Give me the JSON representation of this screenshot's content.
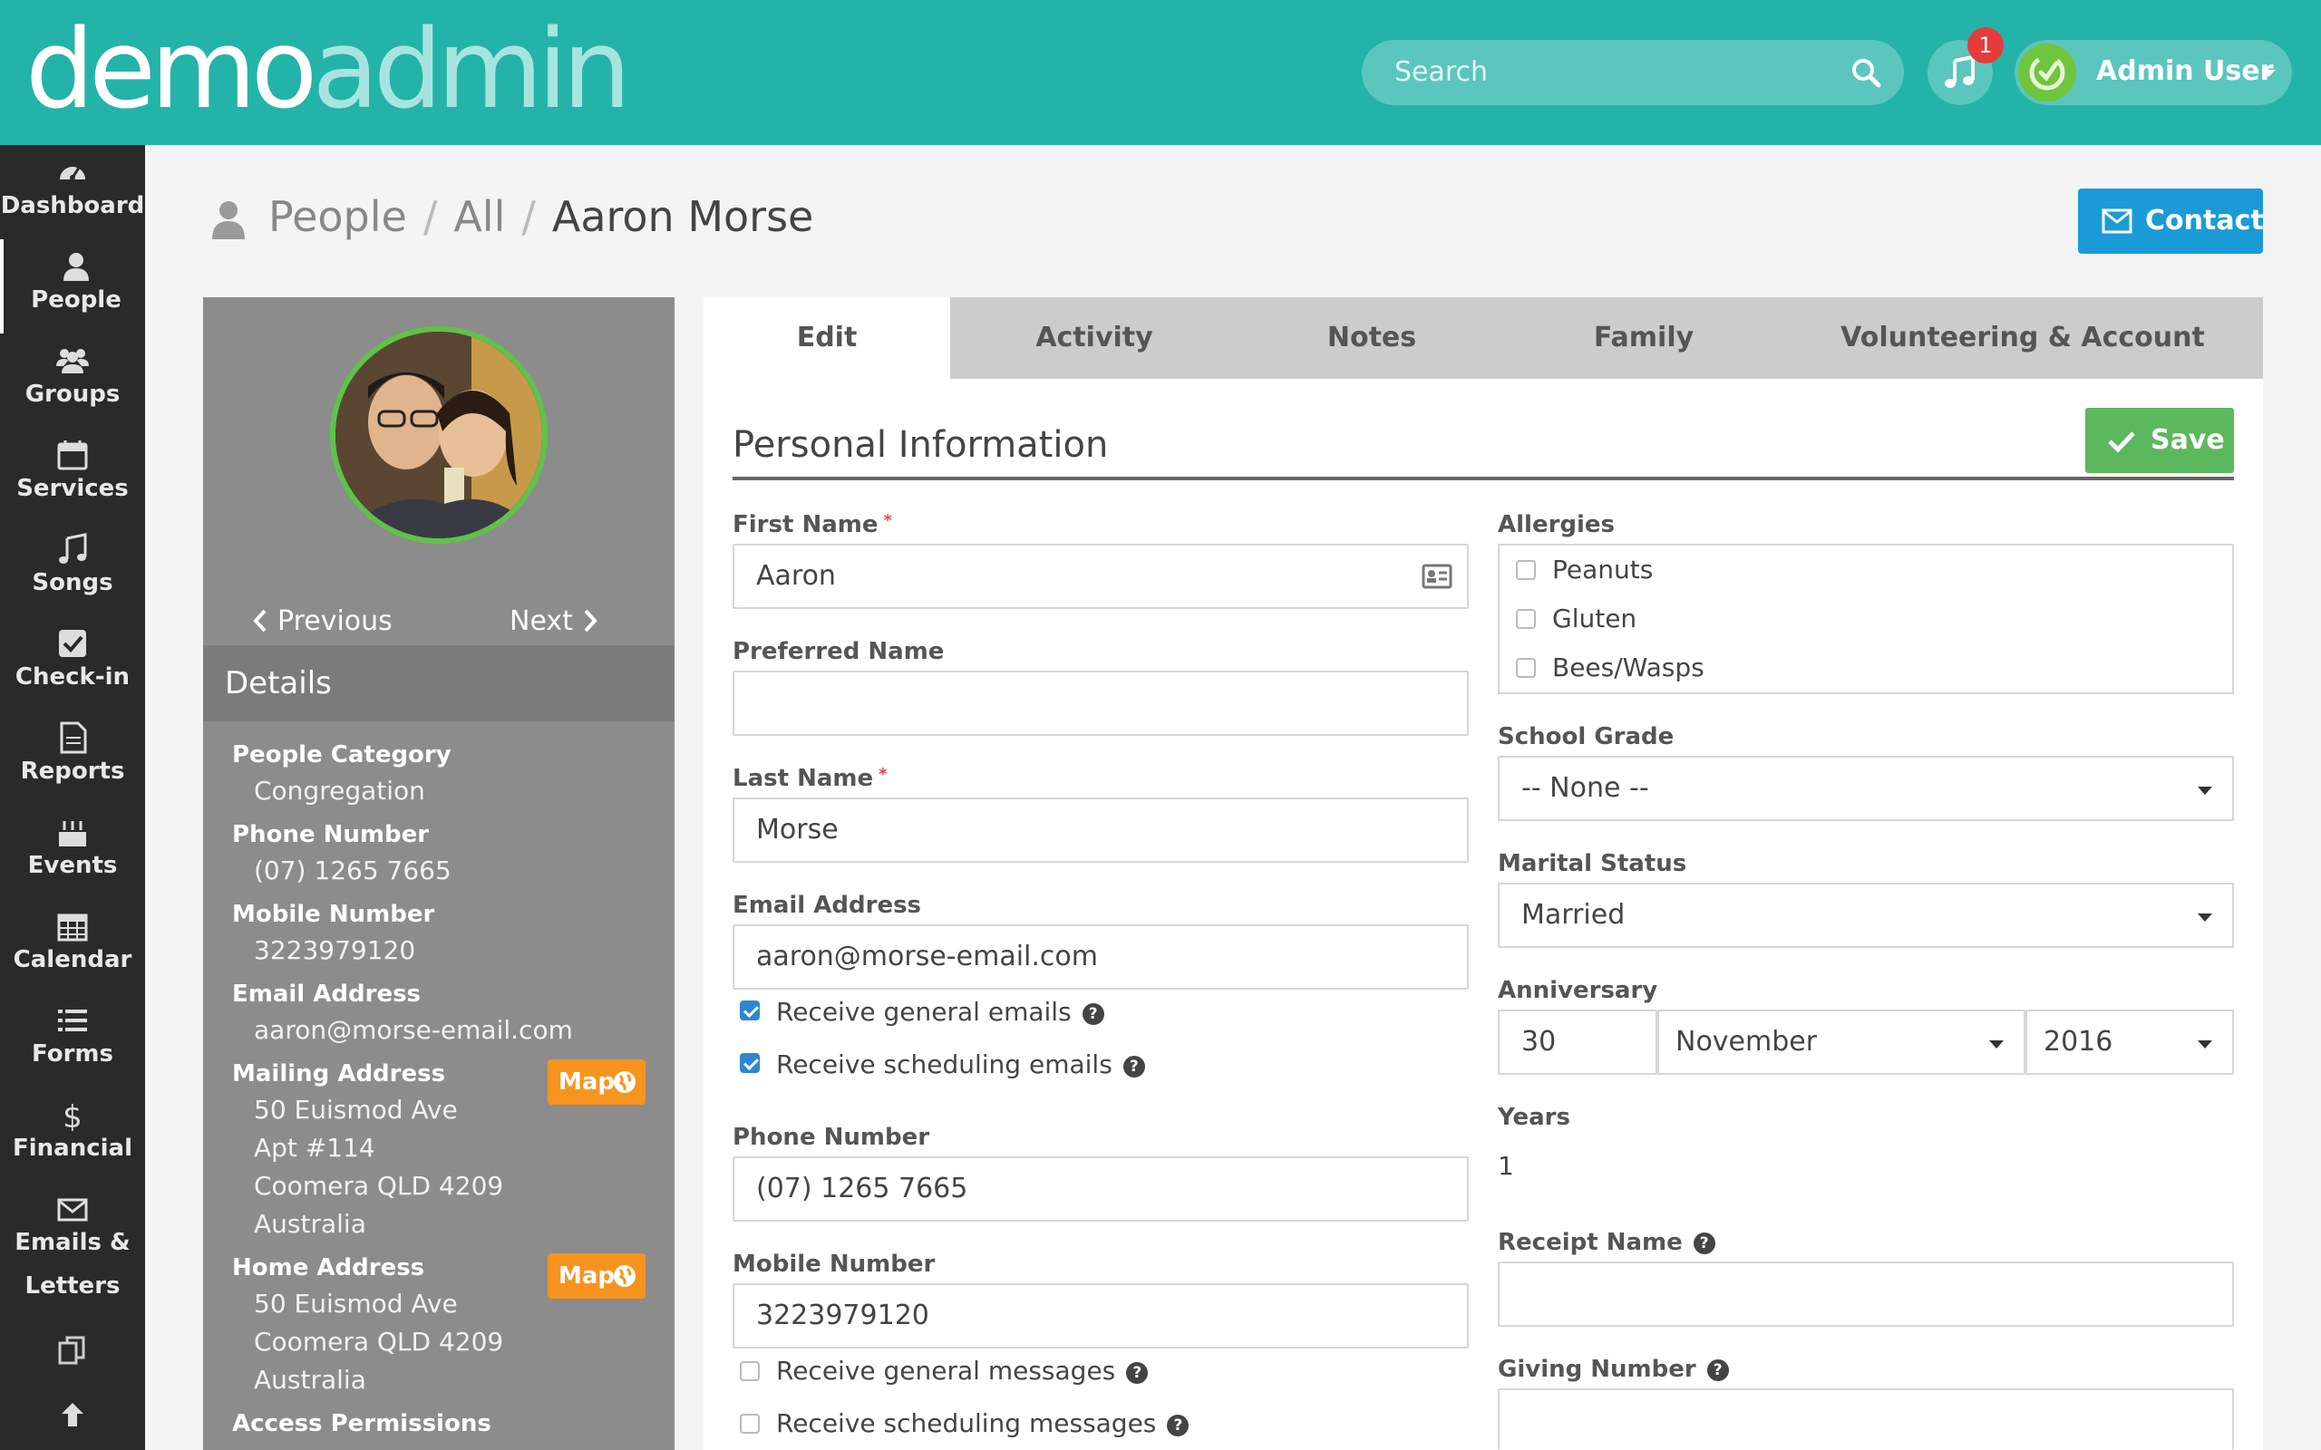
{
  "brand": {
    "logo_part1": "demo",
    "logo_part2": "admin"
  },
  "header": {
    "search_placeholder": "Search",
    "notification_count": "1",
    "user_name": "Admin User"
  },
  "nav": [
    {
      "label": "Dashboard",
      "icon": "dashboard-icon"
    },
    {
      "label": "People",
      "icon": "person-icon"
    },
    {
      "label": "Groups",
      "icon": "groups-icon"
    },
    {
      "label": "Services",
      "icon": "calendar-icon"
    },
    {
      "label": "Songs",
      "icon": "music-icon"
    },
    {
      "label": "Check-in",
      "icon": "checkbox-icon"
    },
    {
      "label": "Reports",
      "icon": "document-icon"
    },
    {
      "label": "Events",
      "icon": "cake-icon"
    },
    {
      "label": "Calendar",
      "icon": "calendar-grid-icon"
    },
    {
      "label": "Forms",
      "icon": "list-icon"
    },
    {
      "label": "Financial",
      "icon": "dollar-icon"
    },
    {
      "label": "Emails &",
      "label2": "Letters",
      "icon": "envelope-icon"
    }
  ],
  "breadcrumb": {
    "root": "People",
    "middle": "All",
    "current": "Aaron Morse"
  },
  "actions": {
    "contact": "Contact",
    "save": "Save"
  },
  "profile": {
    "prev": "Previous",
    "next": "Next",
    "details_title": "Details",
    "map_label": "Map",
    "fields": {
      "category_label": "People Category",
      "category_value": "Congregation",
      "phone_label": "Phone Number",
      "phone_value": "(07) 1265 7665",
      "mobile_label": "Mobile Number",
      "mobile_value": "3223979120",
      "email_label": "Email Address",
      "email_value": "aaron@morse-email.com",
      "mailing_label": "Mailing Address",
      "mailing_lines": [
        "50 Euismod Ave",
        "Apt #114",
        "Coomera QLD 4209",
        "Australia"
      ],
      "home_label": "Home Address",
      "home_lines": [
        "50 Euismod Ave",
        "Coomera QLD 4209",
        "Australia"
      ],
      "access_label": "Access Permissions"
    }
  },
  "tabs": [
    "Edit",
    "Activity",
    "Notes",
    "Family",
    "Volunteering & Account"
  ],
  "form": {
    "section_title": "Personal Information",
    "first_name_label": "First Name",
    "first_name": "Aaron",
    "preferred_name_label": "Preferred Name",
    "preferred_name": "",
    "last_name_label": "Last Name",
    "last_name": "Morse",
    "email_label": "Email Address",
    "email": "aaron@morse-email.com",
    "receive_general_emails": "Receive general emails",
    "receive_scheduling_emails": "Receive scheduling emails",
    "phone_label": "Phone Number",
    "phone": "(07) 1265 7665",
    "mobile_label": "Mobile Number",
    "mobile": "3223979120",
    "receive_general_messages": "Receive general messages",
    "receive_scheduling_messages": "Receive scheduling messages",
    "allergies_label": "Allergies",
    "allergies": [
      "Peanuts",
      "Gluten",
      "Bees/Wasps"
    ],
    "school_grade_label": "School Grade",
    "school_grade": "-- None --",
    "marital_status_label": "Marital Status",
    "marital_status": "Married",
    "anniversary_label": "Anniversary",
    "anniversary_day": "30",
    "anniversary_month": "November",
    "anniversary_year": "2016",
    "years_label": "Years",
    "years": "1",
    "receipt_name_label": "Receipt Name",
    "giving_number_label": "Giving Number"
  },
  "colors": {
    "topbar": "#24b3a8",
    "contact": "#1a9bd7",
    "save": "#5cb85c",
    "map": "#f7941d",
    "badge": "#e53b3b"
  }
}
